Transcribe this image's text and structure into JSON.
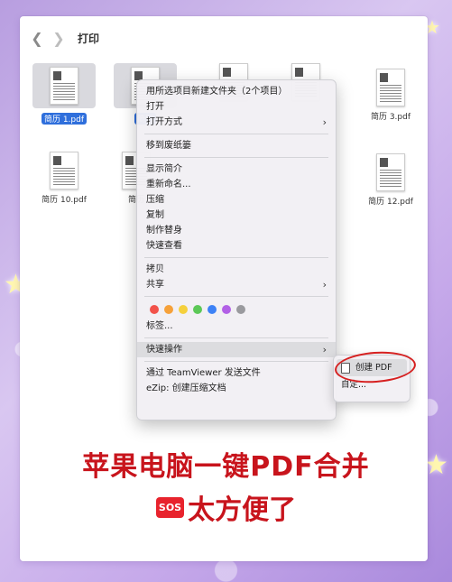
{
  "window": {
    "title": "打印"
  },
  "files": [
    {
      "name": "简历 1.pdf",
      "selected": true
    },
    {
      "name": "简历",
      "selected": true
    },
    {
      "name": "",
      "selected": false
    },
    {
      "name": "",
      "selected": false
    },
    {
      "name": "简历 3.pdf",
      "selected": false
    },
    {
      "name": "简历 10.pdf",
      "selected": false
    },
    {
      "name": "简历",
      "selected": false
    },
    {
      "name": "简历 12.pdf",
      "selected": false
    }
  ],
  "context_menu": {
    "new_folder": "用所选项目新建文件夹（2个项目）",
    "open": "打开",
    "open_with": "打开方式",
    "move_to_trash": "移到废纸篓",
    "get_info": "显示简介",
    "rename": "重新命名...",
    "compress": "压缩",
    "duplicate": "复制",
    "make_alias": "制作替身",
    "quick_look": "快速查看",
    "copy": "拷贝",
    "share": "共享",
    "tag_colors": [
      "#f2524a",
      "#f6a13a",
      "#f5d03c",
      "#5cc857",
      "#3d82f6",
      "#b260e6",
      "#9a9a9e"
    ],
    "tags": "标签...",
    "quick_actions": "快速操作",
    "teamviewer": "通过 TeamViewer 发送文件",
    "ezip": "eZip: 创建压缩文档"
  },
  "submenu": {
    "create_pdf": "创建 PDF",
    "customize": "自定..."
  },
  "caption": {
    "line1": "苹果电脑一键PDF合并",
    "sos": "SOS",
    "line2": "太方便了"
  },
  "colors": {
    "accent": "#2f6fdc",
    "caption": "#c8141c",
    "annotation_circle": "#d62020"
  }
}
